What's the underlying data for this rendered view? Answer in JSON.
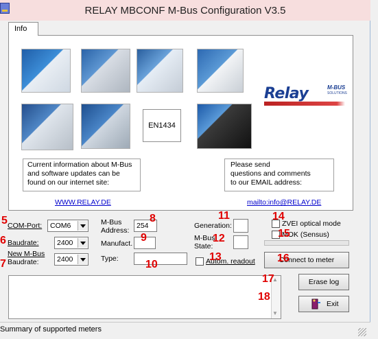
{
  "window": {
    "title": "RELAY MBCONF  M-Bus Configuration  V3.5"
  },
  "tab": {
    "info_label": "Info"
  },
  "products": {
    "standard_button": "EN1434"
  },
  "logo": {
    "word": "Relay",
    "sub": "M-BUS",
    "sub2": "SOLUTIONS"
  },
  "info": {
    "left_lines": [
      "Current information about M-Bus",
      "and software updates can be",
      "found on our internet site:"
    ],
    "right_lines": [
      "Please send",
      "questions and comments",
      "to our EMAIL address:"
    ],
    "website": "WWW.RELAY.DE",
    "email": "mailto:info@RELAY.DE"
  },
  "form": {
    "com_port": {
      "label": "COM-Port:",
      "value": "COM6"
    },
    "baudrate": {
      "label": "Baudrate:",
      "value": "2400"
    },
    "new_baudrate": {
      "label_1": "New M-Bus",
      "label_2": "Baudrate:",
      "value": "2400"
    },
    "address": {
      "label_1": "M-Bus",
      "label_2": "Address:",
      "value": "254"
    },
    "manufact": {
      "label": "Manufact.",
      "value": ""
    },
    "type": {
      "label": "Type:",
      "value": ""
    },
    "autom_readout": {
      "label": "Autom. readout",
      "checked": false
    },
    "generation": {
      "label": "Generation:",
      "value": ""
    },
    "state": {
      "label_1": "M-Bus",
      "label_2": "State:",
      "value": ""
    },
    "zvei": {
      "label": "ZVEI optical mode",
      "checked": false
    },
    "mok": {
      "label": "MOK (Sensus)",
      "checked": false
    }
  },
  "buttons": {
    "connect": "Connect to meter",
    "erase_log": "Erase log",
    "exit": "Exit"
  },
  "markers": [
    "5",
    "6",
    "7",
    "8",
    "9",
    "10",
    "11",
    "12",
    "13",
    "14",
    "15",
    "16",
    "17",
    "18"
  ],
  "status": {
    "text": "Summary of supported meters"
  },
  "colors": {
    "accent": "#1b3f93",
    "marker": "#e00000",
    "link": "#0000cc"
  }
}
